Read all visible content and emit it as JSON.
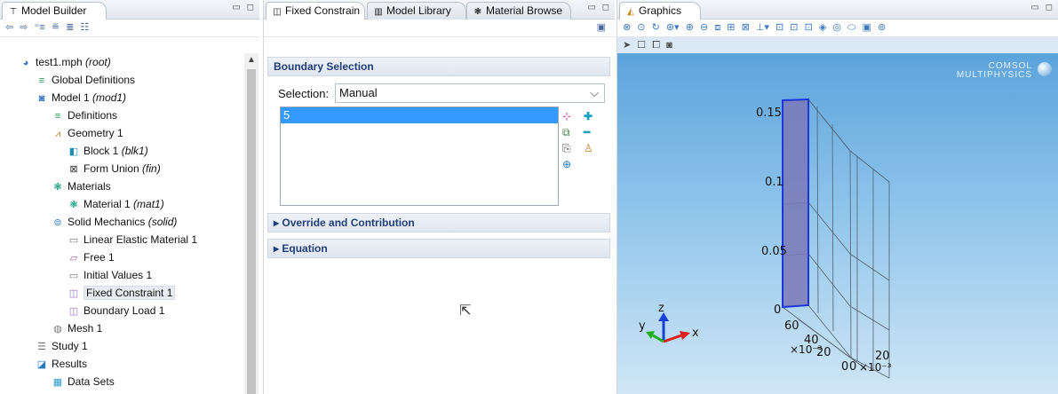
{
  "colors": {
    "accent": "#3399ff",
    "highlight_face": "#7b78b6",
    "bg_top": "#5ca3dc",
    "bg_bottom": "#cfe6f6"
  },
  "model_builder": {
    "tab_label": "Model Builder",
    "tree": [
      {
        "label": "test1.mph",
        "tag": "(root)",
        "icon": "mph-file-icon"
      },
      {
        "label": "Global Definitions",
        "tag": "",
        "icon": "global-definitions-icon"
      },
      {
        "label": "Model 1",
        "tag": "(mod1)",
        "icon": "model-icon"
      },
      {
        "label": "Definitions",
        "tag": "",
        "icon": "definitions-icon"
      },
      {
        "label": "Geometry 1",
        "tag": "",
        "icon": "geometry-icon"
      },
      {
        "label": "Block 1",
        "tag": "(blk1)",
        "icon": "block-icon"
      },
      {
        "label": "Form Union",
        "tag": "(fin)",
        "icon": "form-union-icon"
      },
      {
        "label": "Materials",
        "tag": "",
        "icon": "materials-icon"
      },
      {
        "label": "Material 1",
        "tag": "(mat1)",
        "icon": "material-icon"
      },
      {
        "label": "Solid Mechanics",
        "tag": "(solid)",
        "icon": "solid-mechanics-icon"
      },
      {
        "label": "Linear Elastic Material 1",
        "tag": "",
        "icon": "linear-elastic-icon"
      },
      {
        "label": "Free 1",
        "tag": "",
        "icon": "free-icon"
      },
      {
        "label": "Initial Values 1",
        "tag": "",
        "icon": "initial-values-icon"
      },
      {
        "label": "Fixed Constraint 1",
        "tag": "",
        "icon": "fixed-constraint-icon"
      },
      {
        "label": "Boundary Load 1",
        "tag": "",
        "icon": "boundary-load-icon"
      },
      {
        "label": "Mesh 1",
        "tag": "",
        "icon": "mesh-icon"
      },
      {
        "label": "Study 1",
        "tag": "",
        "icon": "study-icon"
      },
      {
        "label": "Results",
        "tag": "",
        "icon": "results-icon"
      },
      {
        "label": "Data Sets",
        "tag": "",
        "icon": "data-sets-icon"
      }
    ]
  },
  "settings": {
    "tabs": [
      "Fixed Constrain",
      "Model Library",
      "Material Browse"
    ],
    "section_boundary": "Boundary Selection",
    "selection_label": "Selection:",
    "selection_value": "Manual",
    "selected_entities": [
      "5"
    ],
    "section_override": "Override and Contribution",
    "section_equation": "Equation"
  },
  "graphics": {
    "tab_label": "Graphics",
    "logo_line1": "COMSOL",
    "logo_line2": "MULTIPHYSICS",
    "z_ticks": [
      "0.15",
      "0.1",
      "0.05",
      "0"
    ],
    "y_ticks": [
      "60",
      "40",
      "20"
    ],
    "y_exp": "×10⁻³",
    "x_ticks": [
      "0",
      "0",
      "20"
    ],
    "x_exp": "×10⁻³",
    "triad": {
      "z": "z",
      "y": "y",
      "x": "x"
    }
  }
}
